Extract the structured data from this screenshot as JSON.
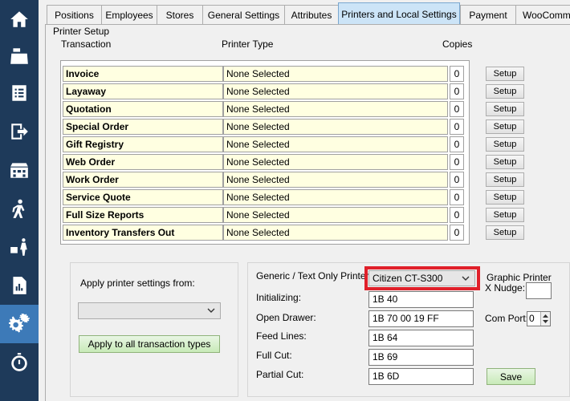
{
  "sidebar": {
    "items": [
      {
        "icon": "home-icon"
      },
      {
        "icon": "cash-register-icon"
      },
      {
        "icon": "receipt-icon"
      },
      {
        "icon": "exit-icon"
      },
      {
        "icon": "building-icon"
      },
      {
        "icon": "walking-person-icon"
      },
      {
        "icon": "delivery-icon"
      },
      {
        "icon": "report-icon"
      },
      {
        "icon": "gears-icon"
      },
      {
        "icon": "stopwatch-icon"
      }
    ],
    "active_index": 8
  },
  "tabs": [
    {
      "label": "Positions"
    },
    {
      "label": "Employees"
    },
    {
      "label": "Stores"
    },
    {
      "label": "General Settings"
    },
    {
      "label": "Attributes"
    },
    {
      "label": "Printers and Local Settings"
    },
    {
      "label": "Payment"
    },
    {
      "label": "WooComme"
    }
  ],
  "active_tab": 5,
  "printer_setup": {
    "section_title": "Printer Setup",
    "col_transaction": "Transaction",
    "col_printer_type": "Printer Type",
    "col_copies": "Copies",
    "setup_label": "Setup",
    "rows": [
      {
        "name": "Invoice",
        "printer_type": "None Selected",
        "copies": "0"
      },
      {
        "name": "Layaway",
        "printer_type": "None Selected",
        "copies": "0"
      },
      {
        "name": "Quotation",
        "printer_type": "None Selected",
        "copies": "0"
      },
      {
        "name": "Special Order",
        "printer_type": "None Selected",
        "copies": "0"
      },
      {
        "name": "Gift Registry",
        "printer_type": "None Selected",
        "copies": "0"
      },
      {
        "name": "Web Order",
        "printer_type": "None Selected",
        "copies": "0"
      },
      {
        "name": "Work Order",
        "printer_type": "None Selected",
        "copies": "0"
      },
      {
        "name": "Service Quote",
        "printer_type": "None Selected",
        "copies": "0"
      },
      {
        "name": "Full Size Reports",
        "printer_type": "None Selected",
        "copies": "0"
      },
      {
        "name": "Inventory Transfers Out",
        "printer_type": "None Selected",
        "copies": "0"
      }
    ]
  },
  "apply_panel": {
    "label": "Apply printer settings from:",
    "select_value": "",
    "button": "Apply to all transaction types"
  },
  "generic_printer": {
    "label": "Generic / Text Only Printer:",
    "selected": "Citizen CT-S300",
    "highlight_color": "#e0202a",
    "fields": [
      {
        "label": "Initializing:",
        "value": "1B 40"
      },
      {
        "label": "Open Drawer:",
        "value": "1B 70 00 19 FF"
      },
      {
        "label": "Feed Lines:",
        "value": "1B 64"
      },
      {
        "label": "Full Cut:",
        "value": "1B 69"
      },
      {
        "label": "Partial Cut:",
        "value": "1B 6D"
      }
    ],
    "graphic_printer_label": "Graphic Printer",
    "x_nudge_label": "X Nudge:",
    "x_nudge_value": "",
    "com_port_label": "Com Port:",
    "com_port_value": "0",
    "save_label": "Save"
  }
}
